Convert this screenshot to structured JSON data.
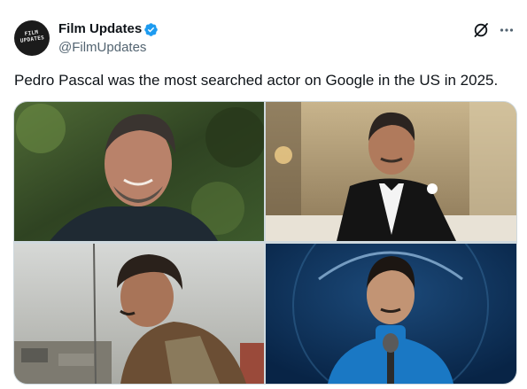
{
  "tweet": {
    "display_name": "Film Updates",
    "handle": "@FilmUpdates",
    "verified": true,
    "text": "Pedro Pascal was the most searched actor on Google in the US in 2025.",
    "avatar_lines": [
      "FILM",
      "UPDATES"
    ]
  },
  "icons": {
    "verified": "verified-badge-icon",
    "grok": "grok-icon",
    "more": "more-horizontal-icon"
  },
  "media": {
    "count": 4,
    "photos": [
      {
        "description_icon": "photo-icon"
      },
      {
        "description_icon": "photo-icon"
      },
      {
        "description_icon": "photo-icon"
      },
      {
        "description_icon": "photo-icon"
      }
    ]
  },
  "colors": {
    "text_primary": "#0f1419",
    "text_secondary": "#536471",
    "verified_blue": "#1d9bf0",
    "border": "#cfd9de"
  }
}
